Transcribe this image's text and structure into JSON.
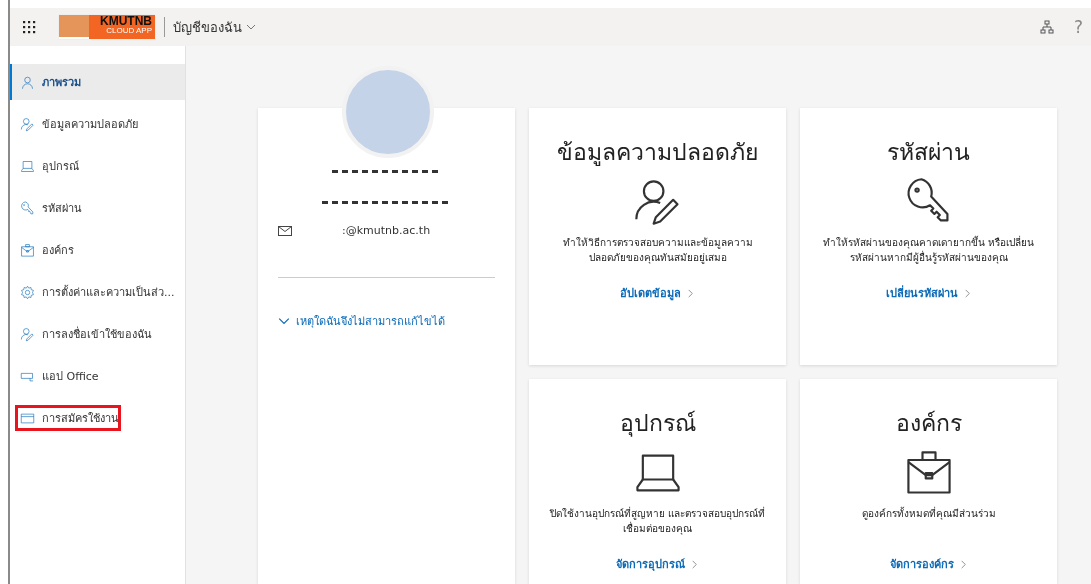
{
  "header": {
    "logo": {
      "title": "KMUTNB",
      "subtitle": "CLOUD APP"
    },
    "account_menu": "บัญชีของฉัน",
    "help": "?"
  },
  "sidebar": {
    "items": [
      {
        "label": "ภาพรวม",
        "kind": "person",
        "selected": true,
        "highlighted": false
      },
      {
        "label": "ข้อมูลความปลอดภัย",
        "kind": "person-edit",
        "selected": false,
        "highlighted": false
      },
      {
        "label": "อุปกรณ์",
        "kind": "laptop",
        "selected": false,
        "highlighted": false
      },
      {
        "label": "รหัสผ่าน",
        "kind": "key",
        "selected": false,
        "highlighted": false
      },
      {
        "label": "องค์กร",
        "kind": "briefcase",
        "selected": false,
        "highlighted": false
      },
      {
        "label": "การตั้งค่าและความเป็นส่ว...",
        "kind": "gear",
        "selected": false,
        "highlighted": false
      },
      {
        "label": "การลงชื่อเข้าใช้ของฉัน",
        "kind": "person-edit",
        "selected": false,
        "highlighted": false
      },
      {
        "label": "แอป Office",
        "kind": "office",
        "selected": false,
        "highlighted": false
      },
      {
        "label": "การสมัครใช้งาน",
        "kind": "card",
        "selected": false,
        "highlighted": true
      }
    ]
  },
  "profile": {
    "email": ":@kmutnb.ac.th",
    "expander": "เหตุใดฉันจึงไม่สามารถแก้ไขได้"
  },
  "cards": [
    {
      "title": "ข้อมูลความปลอดภัย",
      "kind": "person-edit",
      "description": "ทำให้วิธีการตรวจสอบความและข้อมูลความปลอดภัยของคุณทันสมัยอยู่เสมอ",
      "link": "อัปเดตข้อมูล"
    },
    {
      "title": "รหัสผ่าน",
      "kind": "key",
      "description": "ทำให้รหัสผ่านของคุณคาดเดายากขึ้น หรือเปลี่ยนรหัสผ่านหากมีผู้อื่นรู้รหัสผ่านของคุณ",
      "link": "เปลี่ยนรหัสผ่าน"
    },
    {
      "title": "อุปกรณ์",
      "kind": "laptop",
      "description": "ปิดใช้งานอุปกรณ์ที่สูญหาย และตรวจสอบอุปกรณ์ที่เชื่อมต่อของคุณ",
      "link": "จัดการอุปกรณ์"
    },
    {
      "title": "องค์กร",
      "kind": "briefcase",
      "description": "ดูองค์กรทั้งหมดที่คุณมีส่วนร่วม",
      "link": "จัดการองค์กร"
    }
  ]
}
